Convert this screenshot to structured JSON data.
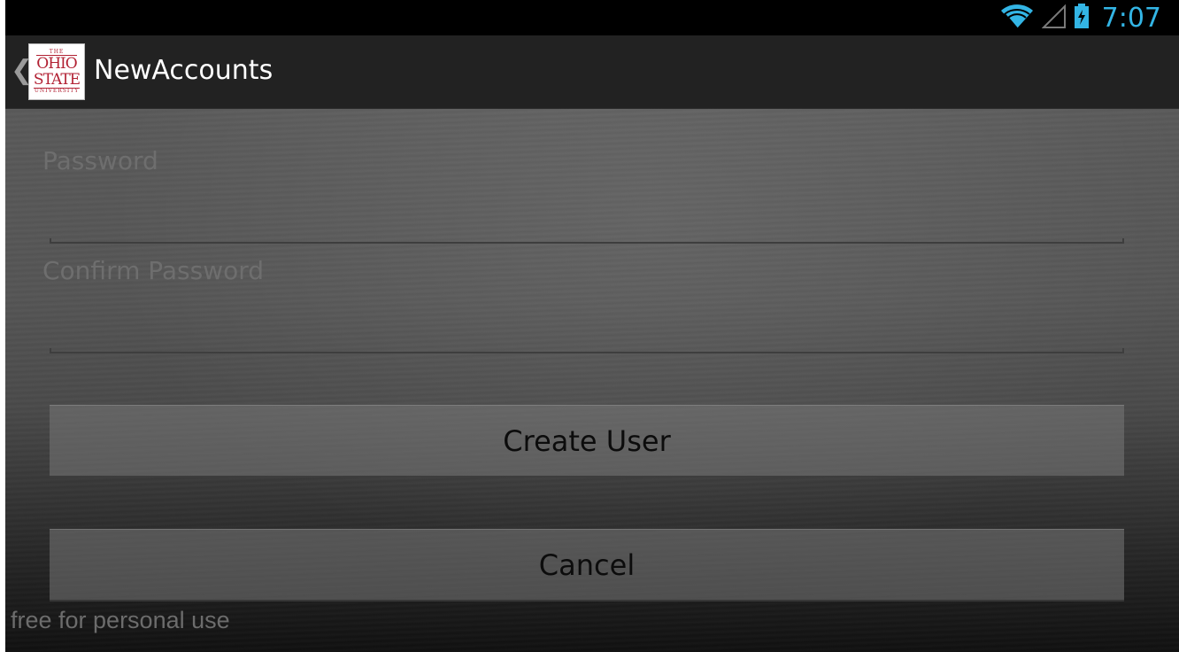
{
  "status_bar": {
    "time": "7:07",
    "icons": [
      "wifi-icon",
      "cell-signal-icon",
      "battery-charging-icon"
    ],
    "accent_color": "#33b5e5"
  },
  "action_bar": {
    "up_glyph": "❮",
    "logo": {
      "name": "ohio-state-logo",
      "text_top": "THE",
      "text_line1": "OHIO",
      "text_line2": "STATE",
      "text_bottom": "UNIVERSITY"
    },
    "title": "NewAccounts"
  },
  "form": {
    "password": {
      "label": "Password",
      "value": ""
    },
    "confirm_password": {
      "label": "Confirm Password",
      "value": ""
    }
  },
  "buttons": {
    "create_user": "Create User",
    "cancel": "Cancel"
  },
  "watermark": "free for personal use"
}
